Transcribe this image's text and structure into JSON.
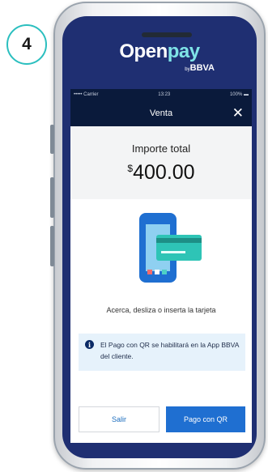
{
  "step": {
    "number": "4"
  },
  "brand": {
    "name_part1": "Open",
    "name_part2": "pay",
    "by": "by",
    "sub": "BBVA"
  },
  "status_bar": {
    "carrier": "••••• Carrier",
    "time": "13:23",
    "battery": "100%"
  },
  "nav": {
    "title": "Venta",
    "close_icon": "close-icon"
  },
  "amount": {
    "label": "Importe total",
    "currency": "$",
    "value": "400.00"
  },
  "illustration": {
    "icon": "phone-card-illustration"
  },
  "instruction": "Acerca, desliza o inserta la tarjeta",
  "info": {
    "icon": "info-icon",
    "text": "El Pago con QR se habilitará en la App BBVA del cliente."
  },
  "buttons": {
    "exit": "Salir",
    "qr": "Pago con QR"
  },
  "colors": {
    "brand_navy": "#1f2f72",
    "nav_dark": "#0a1a3b",
    "accent_teal": "#2bbfbf",
    "primary_blue": "#1f6fd1",
    "info_bg": "#e6f2fb"
  }
}
